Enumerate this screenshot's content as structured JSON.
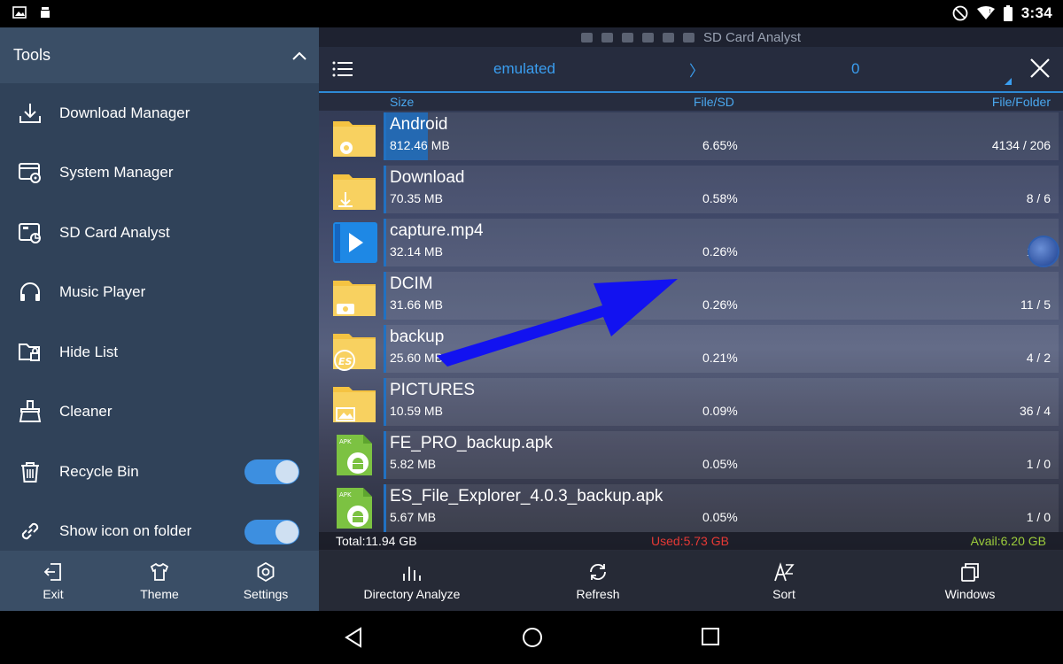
{
  "status_bar": {
    "time": "3:34"
  },
  "drawer": {
    "title": "Tools",
    "items": [
      {
        "label": "Download Manager",
        "icon": "download-icon"
      },
      {
        "label": "System Manager",
        "icon": "system-manager-icon"
      },
      {
        "label": "SD Card Analyst",
        "icon": "sd-card-analyst-icon"
      },
      {
        "label": "Music Player",
        "icon": "headphones-icon"
      },
      {
        "label": "Hide List",
        "icon": "hide-list-icon"
      },
      {
        "label": "Cleaner",
        "icon": "broom-icon"
      },
      {
        "label": "Recycle Bin",
        "icon": "trash-icon",
        "toggle": true
      },
      {
        "label": "Show icon on folder",
        "icon": "link-icon",
        "toggle": true
      }
    ],
    "bottom": [
      {
        "label": "Exit",
        "icon": "exit-icon"
      },
      {
        "label": "Theme",
        "icon": "shirt-icon"
      },
      {
        "label": "Settings",
        "icon": "gear-icon"
      }
    ]
  },
  "panel": {
    "title": "SD Card Analyst",
    "path": {
      "folder": "emulated",
      "separator": "〉",
      "sub": "0"
    },
    "columns": {
      "size": "Size",
      "file_sd": "File/SD",
      "file_folder": "File/Folder"
    },
    "rows": [
      {
        "name": "Android",
        "size": "812.46 MB",
        "pct": "6.65%",
        "count": "4134 / 206",
        "fill": 0.0665,
        "type": "folder-gear"
      },
      {
        "name": "Download",
        "size": "70.35 MB",
        "pct": "0.58%",
        "count": "8 / 6",
        "fill": 0.0058,
        "type": "folder-download"
      },
      {
        "name": "capture.mp4",
        "size": "32.14 MB",
        "pct": "0.26%",
        "count": "1 / 0",
        "fill": 0.0026,
        "type": "video"
      },
      {
        "name": "DCIM",
        "size": "31.66 MB",
        "pct": "0.26%",
        "count": "11 / 5",
        "fill": 0.0026,
        "type": "folder-camera"
      },
      {
        "name": "backup",
        "size": "25.60 MB",
        "pct": "0.21%",
        "count": "4 / 2",
        "fill": 0.0021,
        "type": "folder-es"
      },
      {
        "name": "PICTURES",
        "size": "10.59 MB",
        "pct": "0.09%",
        "count": "36 / 4",
        "fill": 0.0009,
        "type": "folder-image"
      },
      {
        "name": "FE_PRO_backup.apk",
        "size": "5.82 MB",
        "pct": "0.05%",
        "count": "1 / 0",
        "fill": 0.0005,
        "type": "apk"
      },
      {
        "name": "ES_File_Explorer_4.0.3_backup.apk",
        "size": "5.67 MB",
        "pct": "0.05%",
        "count": "1 / 0",
        "fill": 0.0005,
        "type": "apk"
      }
    ],
    "totals": {
      "total": "Total:11.94 GB",
      "used": "Used:5.73 GB",
      "avail": "Avail:6.20 GB"
    },
    "bottom": [
      {
        "label": "Directory Analyze",
        "icon": "bar-chart-icon"
      },
      {
        "label": "Refresh",
        "icon": "refresh-icon"
      },
      {
        "label": "Sort",
        "icon": "sort-az-icon"
      },
      {
        "label": "Windows",
        "icon": "windows-icon"
      }
    ]
  },
  "colors": {
    "accent": "#2e8ad6",
    "used": "#e53935",
    "avail": "#9ccc3c",
    "drawer_bg": "#304259"
  }
}
